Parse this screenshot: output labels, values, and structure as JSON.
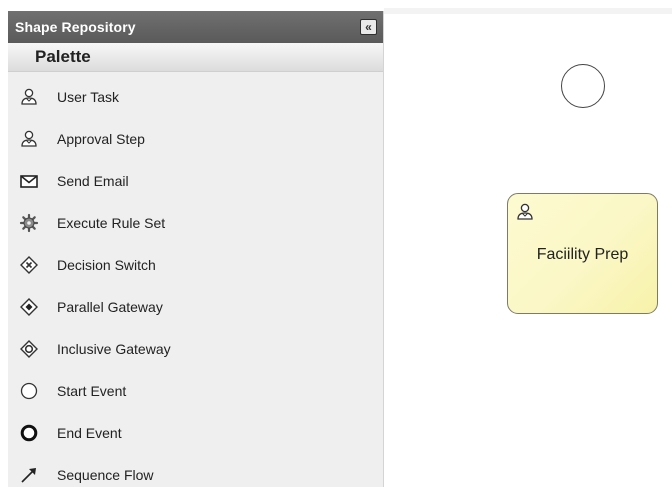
{
  "repository": {
    "title": "Shape Repository",
    "collapse_label": "«"
  },
  "palette": {
    "title": "Palette",
    "items": [
      {
        "label": "User Task",
        "icon": "user-task-icon"
      },
      {
        "label": "Approval Step",
        "icon": "approval-step-icon"
      },
      {
        "label": "Send Email",
        "icon": "envelope-icon"
      },
      {
        "label": "Execute Rule Set",
        "icon": "gear-icon"
      },
      {
        "label": "Decision Switch",
        "icon": "exclusive-gateway-icon"
      },
      {
        "label": "Parallel Gateway",
        "icon": "parallel-gateway-icon"
      },
      {
        "label": "Inclusive Gateway",
        "icon": "inclusive-gateway-icon"
      },
      {
        "label": "Start Event",
        "icon": "start-event-icon"
      },
      {
        "label": "End Event",
        "icon": "end-event-icon"
      },
      {
        "label": "Sequence Flow",
        "icon": "sequence-flow-icon"
      }
    ]
  },
  "canvas": {
    "task_node": {
      "label": "Faciility Prep",
      "icon": "user-task-icon"
    },
    "start_event": {
      "icon": "start-event-icon"
    }
  },
  "colors": {
    "header_bg": "#646464",
    "panel_bg": "#efefef",
    "task_fill": "#fbf7c6",
    "task_border": "#7b7b66"
  }
}
